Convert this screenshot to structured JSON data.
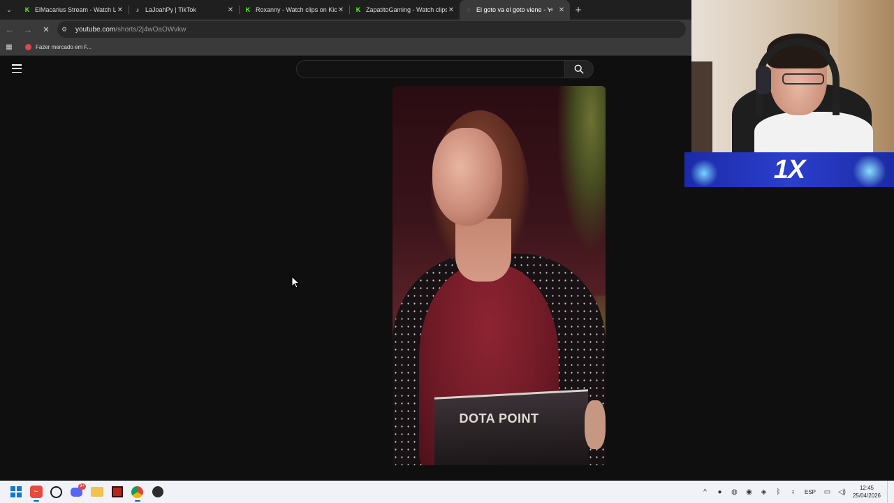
{
  "browser": {
    "tabs": [
      {
        "title": "ElMacarius Stream - Watch Live",
        "favicon": "kick-icon",
        "active": false
      },
      {
        "title": "LaJoahPy | TikTok",
        "favicon": "tiktok-icon",
        "active": false
      },
      {
        "title": "Roxanny - Watch clips on Kick",
        "favicon": "kick-icon",
        "active": false
      },
      {
        "title": "ZapatitoGaming - Watch clips o",
        "favicon": "kick-icon",
        "active": false
      },
      {
        "title": "El goto va el goto viene - Yo",
        "favicon": "youtube-loading-icon",
        "active": true
      }
    ],
    "new_tab_symbol": "+",
    "address": {
      "host": "youtube.com",
      "path": "/shorts/2j4wOaOWvkw"
    },
    "bookmark": {
      "label": "Fazer mercado em F..."
    }
  },
  "youtube": {
    "search_placeholder": "",
    "video": {
      "watermark": "DOTA POINT"
    }
  },
  "overlay": {
    "promo_logo": "1X"
  },
  "taskbar": {
    "language": "ESP",
    "time": "12:45",
    "date": "25/04/2026",
    "discord_badge": "9+"
  }
}
